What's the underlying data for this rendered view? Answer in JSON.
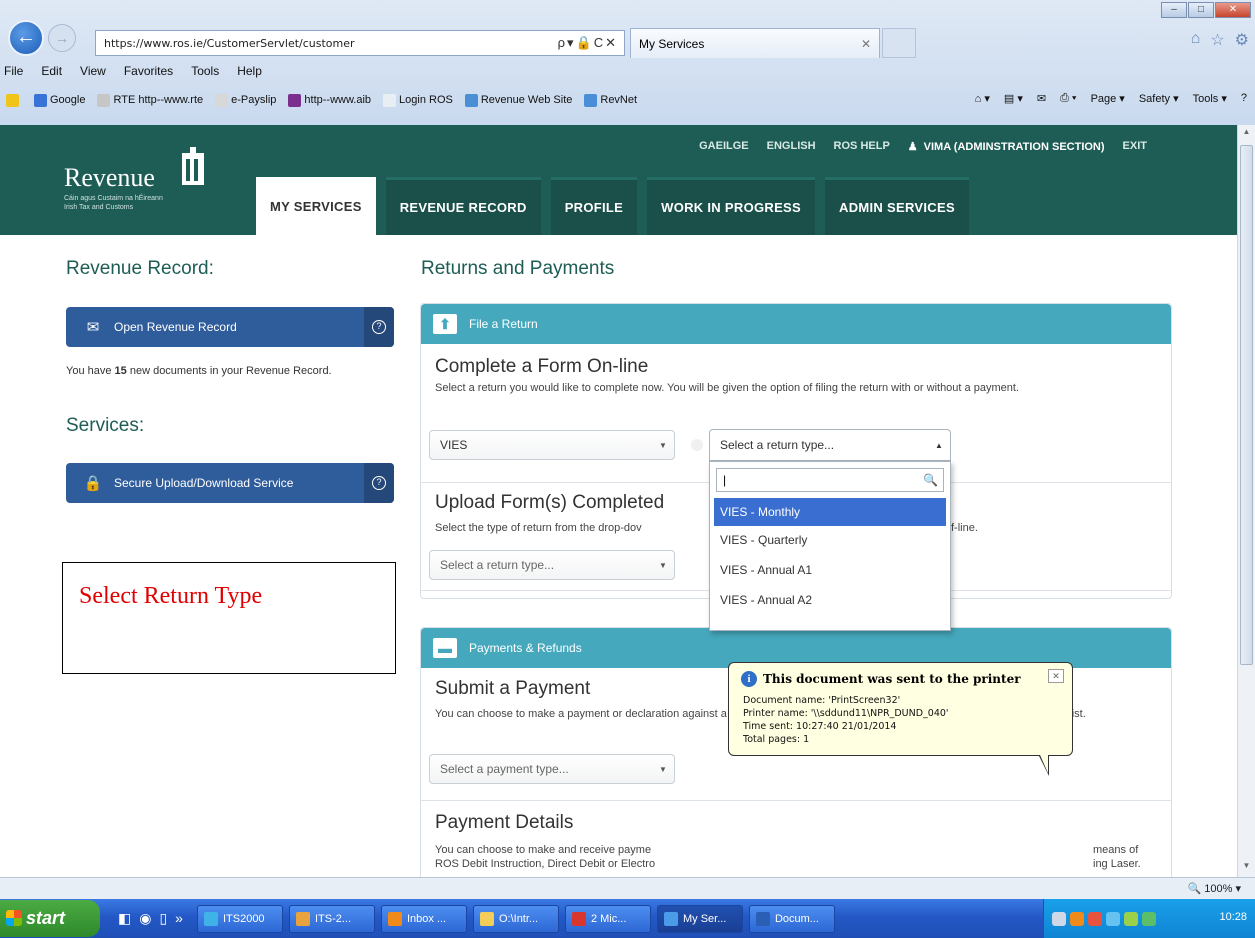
{
  "browser": {
    "address": "https://www.ros.ie/CustomerServlet/customer",
    "address_controls": "ρ▾🔒C✕",
    "tab_title": "My Services",
    "menu": [
      "File",
      "Edit",
      "View",
      "Favorites",
      "Tools",
      "Help"
    ],
    "favorites": [
      "Google",
      "RTE http--www.rte",
      "e-Payslip",
      "http--www.aib",
      "Login ROS",
      "Revenue Web Site",
      "RevNet"
    ],
    "toolbar": [
      "Page ▾",
      "Safety ▾",
      "Tools ▾"
    ],
    "zoom": "100%"
  },
  "header": {
    "brand": "Revenue",
    "brand_sub1": "Cáin agus Custaim na hÉireann",
    "brand_sub2": "Irish Tax and Customs",
    "links": [
      "GAEILGE",
      "ENGLISH",
      "ROS HELP"
    ],
    "user": "VIMA (ADMINSTRATION SECTION)",
    "exit": "EXIT",
    "nav": [
      "MY SERVICES",
      "REVENUE RECORD",
      "PROFILE",
      "WORK IN PROGRESS",
      "ADMIN SERVICES"
    ]
  },
  "left": {
    "revenue_record_heading": "Revenue Record:",
    "open_btn": "Open Revenue Record",
    "new_docs_pre": "You have ",
    "new_docs_count": "15",
    "new_docs_post": " new documents in your Revenue Record.",
    "services_heading": "Services:",
    "secure_btn": "Secure Upload/Download Service",
    "annotation": "Select Return Type"
  },
  "main": {
    "heading": "Returns and Payments",
    "file_return": {
      "title": "File a Return",
      "complete_heading": "Complete a Form On-line",
      "complete_text": "Select a return you would like to complete now. You will be given the option of filing the return with or without a payment.",
      "tax_select": "VIES",
      "return_type_placeholder": "Select a return type...",
      "upload_heading": "Upload Form(s) Completed",
      "upload_text_start": "Select the type of return from the drop-dov",
      "upload_text_end": "f-line.",
      "upload_select": "Select a return type..."
    },
    "dropdown": {
      "options": [
        "VIES - Monthly",
        "VIES - Quarterly",
        "VIES - Annual A1",
        "VIES - Annual A2"
      ],
      "highlighted": "VIES - Monthly"
    },
    "payments": {
      "title": "Payments & Refunds",
      "submit_heading": "Submit a Payment",
      "submit_text": "You can choose to make a payment or declaration against a registered tax by selecting a payment type from the below drop-down list.",
      "payment_select": "Select a payment type...",
      "details_heading": "Payment Details",
      "details_text_1": "You can choose to make and receive payme",
      "details_text_1_end": "means of",
      "details_text_2": "ROS Debit Instruction, Direct Debit or Electro",
      "details_text_2_end": "ing Laser."
    }
  },
  "notification": {
    "title": "This document was sent to the printer",
    "doc": "Document name: 'PrintScreen32'",
    "printer": "Printer name: '\\\\sddund11\\NPR_DUND_040'",
    "time": "Time sent: 10:27:40  21/01/2014",
    "pages": "Total pages: 1"
  },
  "taskbar": {
    "start": "start",
    "items": [
      "ITS2000",
      "ITS-2...",
      "Inbox ...",
      "O:\\Intr...",
      "2 Mic...",
      "My Ser...",
      "Docum..."
    ],
    "clock": "10:28"
  }
}
